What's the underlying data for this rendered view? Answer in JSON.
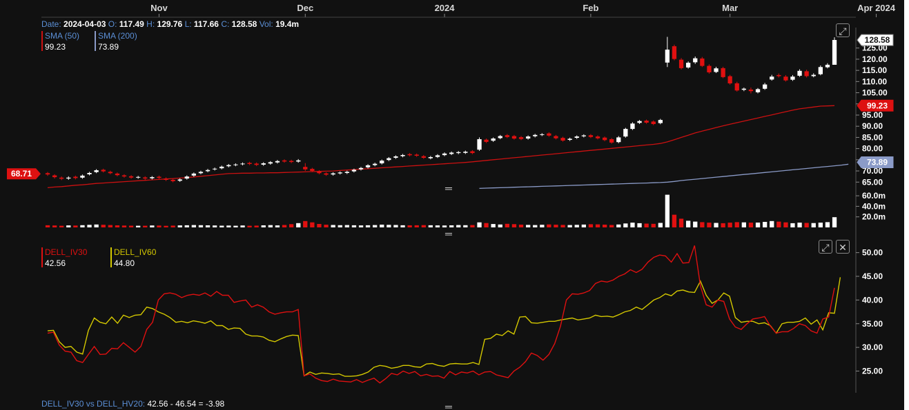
{
  "header": {
    "date_label": "Date:",
    "date": "2024-04-03",
    "open_label": "O:",
    "open": "117.49",
    "high_label": "H:",
    "high": "129.76",
    "low_label": "L:",
    "low": "117.66",
    "close_label": "C:",
    "close": "128.58",
    "vol_label": "Vol:",
    "vol": "19.4m"
  },
  "legend_price": [
    {
      "name": "SMA (50)",
      "value": "99.23",
      "color": "#cc1111"
    },
    {
      "name": "SMA (200)",
      "value": "73.89",
      "color": "#8b9bc8"
    }
  ],
  "legend_iv": [
    {
      "name": "DELL_IV30",
      "value": "42.56",
      "color": "#e01010"
    },
    {
      "name": "DELL_IV60",
      "value": "44.80",
      "color": "#d4c800"
    }
  ],
  "footer": {
    "label": "DELL_IV30 vs DELL_HV20:",
    "expression": "42.56 - 46.54 = -3.98"
  },
  "icons": {
    "expand": "expand-icon",
    "close": "close-icon",
    "drag": "drag-handle-icon"
  },
  "colors": {
    "background": "#111111",
    "down_candle": "#e01010",
    "up_candle": "#ffffff",
    "sma50": "#cc1111",
    "sma200": "#8b9bc8",
    "iv30": "#e01010",
    "iv60": "#d4c800"
  },
  "chart_data": [
    {
      "type": "candlestick",
      "x_tick_labels": [
        "Nov",
        "Dec",
        "2024",
        "Feb",
        "Mar",
        "Apr 2024"
      ],
      "x_tick_index": [
        16,
        37,
        57,
        78,
        98,
        119
      ],
      "y_ticks": [
        65,
        70,
        75,
        80,
        85,
        90,
        95,
        100,
        105,
        110,
        115,
        120,
        125
      ],
      "y_tick_labels": [
        "65.00",
        "70.00",
        "75.00",
        "80.00",
        "85.00",
        "90.00",
        "95.00",
        "100.00",
        "105.00",
        "110.00",
        "115.00",
        "120.00",
        "125.00"
      ],
      "ylim": [
        62,
        132
      ],
      "badges": {
        "last": "128.58",
        "sma50": "99.23",
        "sma200": "73.89",
        "left": "68.71"
      },
      "close": [
        68.4,
        67.2,
        66.5,
        67.0,
        66.8,
        67.9,
        69.1,
        70.3,
        69.8,
        69.0,
        68.1,
        67.5,
        67.0,
        67.3,
        66.6,
        67.2,
        66.9,
        66.0,
        65.4,
        66.2,
        67.5,
        68.8,
        69.6,
        70.4,
        71.0,
        71.9,
        72.6,
        72.9,
        73.3,
        73.1,
        72.7,
        73.4,
        73.9,
        74.4,
        74.2,
        74.0,
        74.7,
        70.7,
        70.0,
        69.0,
        68.3,
        68.9,
        69.3,
        69.6,
        70.5,
        71.3,
        72.5,
        73.2,
        74.6,
        75.7,
        76.5,
        77.1,
        77.0,
        76.8,
        75.9,
        76.2,
        77.0,
        77.8,
        78.2,
        78.4,
        78.6,
        78.0,
        84.2,
        83.0,
        84.5,
        85.6,
        85.2,
        84.5,
        84.3,
        85.4,
        86.1,
        86.4,
        85.8,
        84.6,
        83.6,
        84.4,
        85.4,
        85.9,
        85.2,
        84.6,
        83.8,
        82.7,
        85.0,
        88.8,
        91.2,
        92.3,
        91.6,
        91.0,
        92.8,
        124.3,
        120.1,
        116.0,
        118.4,
        120.4,
        117.0,
        114.1,
        115.9,
        112.0,
        109.2,
        106.0,
        106.8,
        105.7,
        106.6,
        108.7,
        112.2,
        112.4,
        110.5,
        112.2,
        114.8,
        112.4,
        113.0,
        116.5,
        117.5,
        128.6
      ],
      "open": [
        69.0,
        68.0,
        67.0,
        66.6,
        67.4,
        67.0,
        68.5,
        69.5,
        70.5,
        69.6,
        68.8,
        68.0,
        67.6,
        67.0,
        67.1,
        66.7,
        67.4,
        66.6,
        66.0,
        65.6,
        66.6,
        67.9,
        69.0,
        69.9,
        70.7,
        71.2,
        72.1,
        72.6,
        73.0,
        73.6,
        73.3,
        72.8,
        73.3,
        73.8,
        74.7,
        74.5,
        74.2,
        71.8,
        70.9,
        69.8,
        68.9,
        68.4,
        68.9,
        69.1,
        69.8,
        70.7,
        71.6,
        72.6,
        73.4,
        74.9,
        75.9,
        76.6,
        77.5,
        77.3,
        76.6,
        75.7,
        76.3,
        77.1,
        77.6,
        78.0,
        78.1,
        78.8,
        79.5,
        84.0,
        83.5,
        84.7,
        86.0,
        85.6,
        85.1,
        84.5,
        85.5,
        86.1,
        86.8,
        85.6,
        84.8,
        83.9,
        84.8,
        85.5,
        86.0,
        85.4,
        84.9,
        84.2,
        82.9,
        85.4,
        88.8,
        91.5,
        92.5,
        92.1,
        91.4,
        118.5,
        125.8,
        119.8,
        116.3,
        118.6,
        120.3,
        117.0,
        114.3,
        116.0,
        112.4,
        109.2,
        106.3,
        106.4,
        105.2,
        106.8,
        110.9,
        112.9,
        112.2,
        110.8,
        112.6,
        114.6,
        112.4,
        113.3,
        116.4,
        117.5
      ],
      "high": [
        69.5,
        68.5,
        67.5,
        67.6,
        67.9,
        68.4,
        69.6,
        70.8,
        71.0,
        70.1,
        69.3,
        68.5,
        68.1,
        67.8,
        67.6,
        67.7,
        67.9,
        67.1,
        66.5,
        66.7,
        68.0,
        69.3,
        70.1,
        70.9,
        71.5,
        72.4,
        73.1,
        73.4,
        73.8,
        74.1,
        73.8,
        73.9,
        74.4,
        74.9,
        75.2,
        75.0,
        75.3,
        73.5,
        71.4,
        70.3,
        69.4,
        69.4,
        69.8,
        70.1,
        71.0,
        71.8,
        73.0,
        73.7,
        75.1,
        76.2,
        77.0,
        77.6,
        78.0,
        77.8,
        77.1,
        76.7,
        77.5,
        78.3,
        78.7,
        78.9,
        79.1,
        79.3,
        85.0,
        84.5,
        85.0,
        86.1,
        86.5,
        86.1,
        85.6,
        85.9,
        86.6,
        86.9,
        87.3,
        86.1,
        85.3,
        84.9,
        85.9,
        86.4,
        86.5,
        85.9,
        85.4,
        84.7,
        85.6,
        89.3,
        91.8,
        92.8,
        93.0,
        92.6,
        93.3,
        130.0,
        126.5,
        120.5,
        119.0,
        121.2,
        121.0,
        117.7,
        116.6,
        116.6,
        113.0,
        109.9,
        107.3,
        107.3,
        107.1,
        109.4,
        113.0,
        113.6,
        112.9,
        112.9,
        115.5,
        115.3,
        113.7,
        117.2,
        118.2,
        129.8
      ],
      "low": [
        67.8,
        66.6,
        65.9,
        66.0,
        66.2,
        66.5,
        68.0,
        69.0,
        69.3,
        68.5,
        67.6,
        67.0,
        66.5,
        66.5,
        66.0,
        66.2,
        66.4,
        65.5,
        64.9,
        65.1,
        66.1,
        67.4,
        68.5,
        69.4,
        70.2,
        70.7,
        71.6,
        72.1,
        72.5,
        72.6,
        72.2,
        72.3,
        72.8,
        73.3,
        73.7,
        73.5,
        73.7,
        70.0,
        69.5,
        68.5,
        67.8,
        67.9,
        68.4,
        68.6,
        69.3,
        70.2,
        71.1,
        72.1,
        72.9,
        74.4,
        75.4,
        76.1,
        76.5,
        76.3,
        75.4,
        75.2,
        75.8,
        76.6,
        77.1,
        77.5,
        77.6,
        77.5,
        79.0,
        82.5,
        83.0,
        84.2,
        84.7,
        84.0,
        83.8,
        84.0,
        85.0,
        85.6,
        85.3,
        84.1,
        83.1,
        83.4,
        84.3,
        85.0,
        84.7,
        84.1,
        83.3,
        82.2,
        82.4,
        84.9,
        88.3,
        91.0,
        91.1,
        90.5,
        90.9,
        116.5,
        119.5,
        115.4,
        115.8,
        117.9,
        116.5,
        113.5,
        113.8,
        111.5,
        108.6,
        105.5,
        105.7,
        104.7,
        104.7,
        106.3,
        110.4,
        111.8,
        110.0,
        110.3,
        112.1,
        111.8,
        111.9,
        112.8,
        115.9,
        117.7
      ],
      "volume": [
        4.0,
        3.6,
        3.2,
        3.8,
        3.5,
        4.2,
        4.8,
        5.5,
        5.0,
        4.4,
        3.9,
        3.5,
        3.3,
        3.1,
        3.2,
        3.6,
        3.5,
        3.0,
        3.4,
        3.8,
        4.1,
        4.5,
        4.2,
        3.9,
        3.6,
        3.3,
        3.5,
        3.2,
        3.6,
        3.1,
        3.4,
        3.9,
        4.3,
        3.8,
        4.6,
        6.2,
        8.1,
        12.0,
        9.5,
        6.5,
        5.1,
        4.6,
        4.2,
        4.4,
        4.0,
        3.8,
        4.1,
        4.5,
        5.2,
        4.9,
        4.6,
        4.1,
        3.9,
        4.0,
        4.3,
        4.1,
        3.8,
        3.6,
        3.9,
        4.4,
        4.2,
        4.5,
        9.5,
        8.2,
        6.4,
        5.5,
        6.8,
        6.1,
        5.2,
        4.7,
        4.5,
        5.0,
        5.6,
        5.1,
        4.7,
        4.4,
        4.8,
        5.3,
        6.0,
        5.8,
        5.2,
        4.6,
        5.5,
        7.5,
        9.0,
        8.0,
        7.2,
        6.8,
        8.5,
        62.0,
        24.0,
        16.5,
        12.5,
        11.0,
        10.0,
        9.0,
        8.5,
        8.0,
        9.0,
        10.0,
        9.5,
        9.0,
        9.2,
        10.5,
        12.0,
        11.0,
        9.5,
        8.0,
        9.0,
        8.5,
        8.2,
        9.0,
        10.0,
        19.4
      ],
      "volume_ylim": [
        0,
        68
      ],
      "volume_ticks": [
        20,
        40,
        60
      ],
      "volume_tick_labels": [
        "20.0m",
        "40.0m",
        "60.0m"
      ],
      "sma50": [
        62.5,
        62.8,
        63.0,
        63.3,
        63.6,
        63.8,
        64.1,
        64.4,
        64.6,
        64.8,
        65.0,
        65.2,
        65.4,
        65.6,
        65.8,
        66.0,
        66.2,
        66.4,
        66.6,
        66.8,
        67.0,
        67.3,
        67.6,
        67.9,
        68.2,
        68.5,
        68.8,
        68.9,
        69.0,
        69.0,
        69.1,
        69.1,
        69.2,
        69.2,
        69.3,
        69.4,
        69.5,
        69.6,
        69.7,
        69.8,
        69.9,
        70.0,
        70.2,
        70.4,
        70.6,
        70.8,
        71.0,
        71.2,
        71.4,
        71.6,
        71.8,
        72.0,
        72.2,
        72.4,
        72.6,
        72.8,
        73.0,
        73.2,
        73.4,
        73.6,
        73.8,
        74.1,
        74.4,
        74.7,
        75.0,
        75.3,
        75.6,
        75.9,
        76.2,
        76.5,
        76.8,
        77.1,
        77.4,
        77.7,
        78.0,
        78.3,
        78.6,
        78.9,
        79.2,
        79.5,
        79.8,
        80.1,
        80.4,
        80.7,
        81.0,
        81.3,
        81.6,
        81.9,
        82.3,
        83.0,
        84.0,
        85.0,
        86.0,
        87.0,
        87.8,
        88.6,
        89.4,
        90.2,
        90.9,
        91.6,
        92.3,
        93.0,
        93.7,
        94.4,
        95.1,
        95.8,
        96.5,
        97.2,
        97.8,
        98.2,
        98.6,
        99.0,
        99.1,
        99.23
      ],
      "sma200_start_index": 62,
      "sma200": [
        62.2,
        62.3,
        62.4,
        62.5,
        62.6,
        62.7,
        62.8,
        62.9,
        63.0,
        63.1,
        63.2,
        63.3,
        63.4,
        63.5,
        63.6,
        63.7,
        63.8,
        63.9,
        64.0,
        64.1,
        64.2,
        64.3,
        64.4,
        64.5,
        64.6,
        64.7,
        64.8,
        65.0,
        65.3,
        65.7,
        66.0,
        66.3,
        66.6,
        66.9,
        67.2,
        67.5,
        67.8,
        68.1,
        68.4,
        68.7,
        69.0,
        69.3,
        69.6,
        69.9,
        70.2,
        70.5,
        70.8,
        71.1,
        71.4,
        71.7,
        72.0,
        72.3,
        72.6,
        73.0
      ]
    },
    {
      "type": "line",
      "ylim": [
        21,
        53
      ],
      "y_ticks": [
        25,
        30,
        35,
        40,
        45,
        50
      ],
      "y_tick_labels": [
        "25.00",
        "30.00",
        "35.00",
        "40.00",
        "45.00",
        "50.00"
      ],
      "series": [
        {
          "name": "DELL_IV30",
          "color": "#e01010",
          "values": [
            33.0,
            33.2,
            30.5,
            29.2,
            29.0,
            27.2,
            26.8,
            28.5,
            30.2,
            28.5,
            28.6,
            29.8,
            29.7,
            31.0,
            30.0,
            29.0,
            30.2,
            33.8,
            35.3,
            40.0,
            41.3,
            41.5,
            41.2,
            40.5,
            41.0,
            41.2,
            41.0,
            41.5,
            40.8,
            41.8,
            41.0,
            41.0,
            39.5,
            39.8,
            40.0,
            38.5,
            39.0,
            38.5,
            37.5,
            37.0,
            37.3,
            37.5,
            37.5,
            38.0,
            24.0,
            24.4,
            23.5,
            23.0,
            22.8,
            23.3,
            22.9,
            22.8,
            22.7,
            23.2,
            22.6,
            23.1,
            23.5,
            22.5,
            23.4,
            24.5,
            24.2,
            25.0,
            24.5,
            24.9,
            24.0,
            24.3,
            23.9,
            24.0,
            23.5,
            24.9,
            24.2,
            24.8,
            24.6,
            25.0,
            24.2,
            24.8,
            24.9,
            24.2,
            23.9,
            23.6,
            25.0,
            25.8,
            27.0,
            28.8,
            28.3,
            27.3,
            28.5,
            30.8,
            34.5,
            40.0,
            41.3,
            41.2,
            41.5,
            42.0,
            43.5,
            44.0,
            43.8,
            44.2,
            45.0,
            45.5,
            46.4,
            45.8,
            46.5,
            48.0,
            49.0,
            49.5,
            49.3,
            48.0,
            49.8,
            47.8,
            47.9,
            51.5,
            43.0,
            39.0,
            38.5,
            40.0,
            39.7,
            36.0,
            34.3,
            33.8,
            35.0,
            36.0,
            36.2,
            36.5,
            34.5,
            33.0,
            33.3,
            33.3,
            34.0,
            35.0,
            34.6,
            33.5,
            33.0,
            36.0,
            36.4,
            42.56
          ]
        },
        {
          "name": "DELL_IV60",
          "color": "#d4c800",
          "values": [
            33.5,
            33.6,
            31.2,
            30.0,
            30.2,
            29.0,
            28.6,
            33.6,
            36.2,
            35.3,
            35.0,
            36.4,
            35.1,
            36.8,
            36.3,
            36.8,
            36.9,
            38.5,
            38.2,
            37.5,
            37.0,
            36.3,
            35.3,
            35.5,
            35.2,
            35.6,
            35.4,
            35.1,
            35.6,
            34.6,
            34.6,
            33.8,
            34.1,
            34.0,
            32.8,
            32.4,
            32.4,
            32.2,
            31.5,
            31.2,
            31.8,
            32.3,
            32.6,
            32.5,
            24.0,
            24.8,
            24.3,
            24.6,
            24.5,
            24.3,
            24.4,
            23.9,
            23.9,
            24.0,
            24.3,
            24.8,
            25.8,
            26.2,
            26.0,
            25.6,
            25.8,
            26.2,
            26.2,
            25.9,
            25.8,
            26.5,
            26.6,
            26.2,
            26.0,
            26.5,
            26.6,
            26.5,
            26.5,
            26.8,
            26.4,
            31.7,
            31.9,
            32.8,
            32.5,
            33.5,
            32.8,
            36.4,
            36.5,
            35.2,
            35.1,
            35.3,
            35.5,
            35.5,
            35.8,
            36.0,
            36.2,
            35.8,
            36.0,
            36.2,
            36.8,
            36.5,
            36.6,
            36.4,
            36.9,
            37.5,
            37.8,
            38.5,
            38.0,
            39.0,
            40.0,
            40.5,
            41.3,
            40.9,
            41.9,
            42.1,
            41.7,
            41.6,
            44.0,
            41.0,
            39.3,
            40.0,
            41.5,
            40.8,
            36.3,
            35.3,
            35.5,
            35.5,
            35.0,
            35.2,
            34.6,
            33.0,
            35.0,
            35.3,
            35.3,
            35.5,
            36.2,
            34.9,
            35.8,
            33.7,
            37.3,
            37.2,
            44.8
          ]
        }
      ]
    }
  ]
}
